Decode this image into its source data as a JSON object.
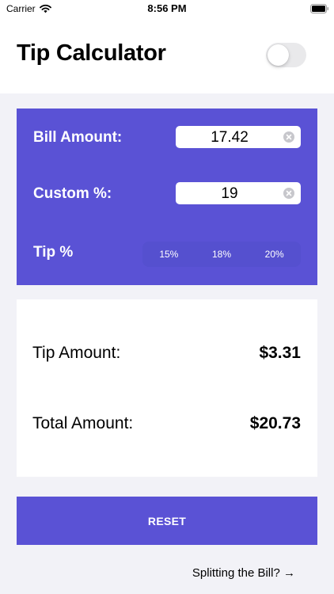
{
  "status_bar": {
    "carrier": "Carrier",
    "time": "8:56 PM"
  },
  "header": {
    "title": "Tip Calculator",
    "toggle_on": false
  },
  "inputs": {
    "bill_label": "Bill Amount:",
    "bill_value": "17.42",
    "custom_label": "Custom %:",
    "custom_value": "19",
    "tip_label": "Tip %",
    "tip_options": [
      "15%",
      "18%",
      "20%"
    ]
  },
  "results": {
    "tip_label": "Tip Amount:",
    "tip_value": "$3.31",
    "total_label": "Total Amount:",
    "total_value": "$20.73"
  },
  "actions": {
    "reset_label": "RESET",
    "split_label": "Splitting the Bill? →"
  },
  "colors": {
    "accent": "#5a52d5",
    "background": "#f2f2f7"
  }
}
